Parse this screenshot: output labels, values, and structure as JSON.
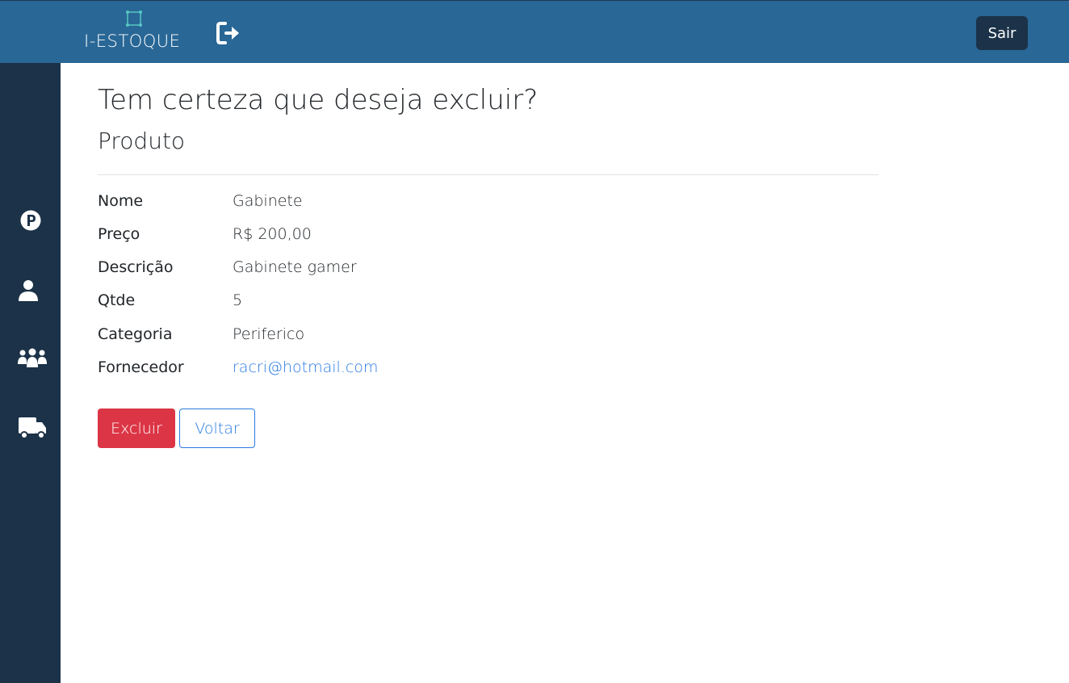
{
  "header": {
    "logo_text": "I-ESTOQUE",
    "logout_icon": "sign-out-icon",
    "sair_label": "Sair"
  },
  "sidebar": {
    "items": [
      {
        "icon": "product-p-icon",
        "label": "Produtos"
      },
      {
        "icon": "user-icon",
        "label": "Usuário"
      },
      {
        "icon": "users-group-icon",
        "label": "Clientes"
      },
      {
        "icon": "truck-icon",
        "label": "Fornecedores"
      }
    ]
  },
  "main": {
    "title": "Tem certeza que deseja excluir?",
    "subtitle": "Produto",
    "fields": [
      {
        "label": "Nome",
        "value": "Gabinete"
      },
      {
        "label": "Preço",
        "value": "R$ 200,00"
      },
      {
        "label": "Descrição",
        "value": "Gabinete gamer"
      },
      {
        "label": "Qtde",
        "value": "5"
      },
      {
        "label": "Categoria",
        "value": "Periferico"
      },
      {
        "label": "Fornecedor",
        "value": "racri@hotmail.com"
      }
    ],
    "delete_label": "Excluir",
    "back_label": "Voltar"
  },
  "colors": {
    "header_bg": "#296796",
    "sidebar_bg": "#1b3248",
    "danger": "#dc3545",
    "primary": "#2a7ae2"
  }
}
